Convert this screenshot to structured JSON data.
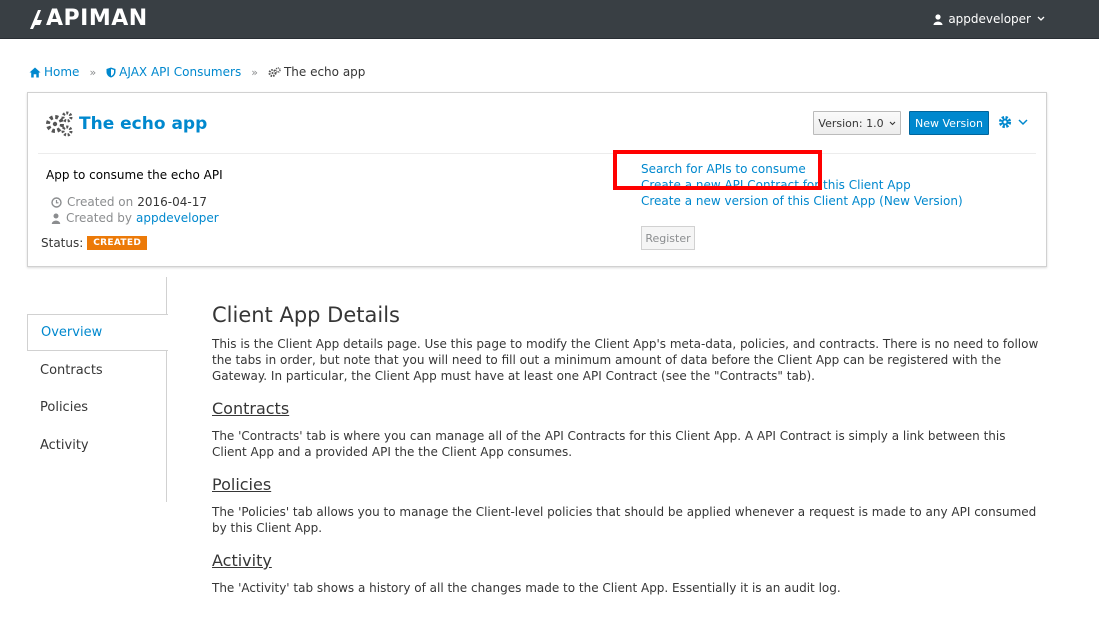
{
  "navbar": {
    "logo_text": "APIMAN",
    "user": "appdeveloper"
  },
  "breadcrumb": {
    "home": "Home",
    "org": "AJAX API Consumers",
    "current": "The echo app"
  },
  "app": {
    "title": "The echo app",
    "version_label": "Version: 1.0",
    "new_version_label": "New Version",
    "description": "App to consume the echo API",
    "created_on_label": "Created on",
    "created_on": "2016-04-17",
    "created_by_label": "Created by",
    "created_by": "appdeveloper",
    "status_label": "Status:",
    "status": "CREATED",
    "status_color": "#ec7a08"
  },
  "actions": {
    "search": "Search for APIs to consume",
    "new_contract": "Create a new API Contract for this Client App",
    "new_version": "Create a new version of this Client App (New Version)",
    "register": "Register"
  },
  "tabs": [
    {
      "label": "Overview",
      "active": true
    },
    {
      "label": "Contracts"
    },
    {
      "label": "Policies"
    },
    {
      "label": "Activity"
    }
  ],
  "content": {
    "title": "Client App Details",
    "intro": "This is the Client App details page. Use this page to modify the Client App's meta-data, policies, and contracts. There is no need to follow the tabs in order, but note that you will need to fill out a minimum amount of data before the Client App can be registered with the Gateway. In particular, the Client App must have at least one API Contract (see the \"Contracts\" tab).",
    "sections": [
      {
        "heading": "Contracts",
        "text": "The 'Contracts' tab is where you can manage all of the API Contracts for this Client App. A API Contract is simply a link between this Client App and a provided API the the Client App consumes."
      },
      {
        "heading": "Policies",
        "text": "The 'Policies' tab allows you to manage the Client-level policies that should be applied whenever a request is made to any API consumed by this Client App."
      },
      {
        "heading": "Activity",
        "text": "The 'Activity' tab shows a history of all the changes made to the Client App. Essentially it is an audit log."
      }
    ]
  },
  "colors": {
    "accent": "#0088ce",
    "navbar": "#393f44",
    "highlight": "#ff0000"
  }
}
